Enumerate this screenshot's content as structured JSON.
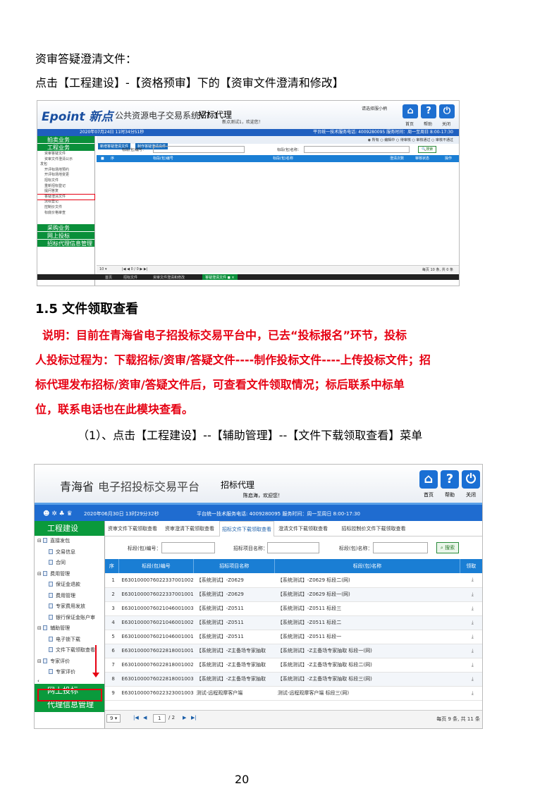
{
  "doc": {
    "p1": "资审答疑澄清文件：",
    "p2": "点击【工程建设】-【资格预审】下的【资审文件澄清和修改】",
    "h15": "1.5 文件领取查看",
    "note": [
      "说明：目前在青海省电子招投标交易平台中，已去“投标报名”环节，投标",
      "人投标过程为：下载招标/资审/答疑文件----制作投标文件----上传投标文件；招",
      "标代理发布招标/资审/答疑文件后，可查看文件领取情况；标后联系中标单",
      "位，联系电话也在此模块查看。"
    ],
    "p3": "（1）、点击【工程建设】--【辅助管理】--【文件下载领取查看】菜单",
    "page": "20"
  },
  "shot1": {
    "logo": "Epoint 新点",
    "system": "公共资源电子交易系统V7.1",
    "role": "招标代理",
    "user": "新点测试1，欢迎您！",
    "select_hint": "请选择服小柄",
    "icons": [
      {
        "name": "home-icon",
        "glyph": "⌂",
        "label": "首页"
      },
      {
        "name": "help-icon",
        "glyph": "?",
        "label": "帮助"
      },
      {
        "name": "power-icon",
        "glyph": "⏻",
        "label": "关闭"
      }
    ],
    "date": "2020年07月24日 11时34分51秒",
    "hotline": "平台统一技术服务电话: 4009280095 服务时间：周一至周日 8:00-17:30",
    "side_groups_top": [
      "拍卖业务",
      "工程业务"
    ],
    "tree": [
      "资审答疑文件",
      "资审文件澄清公示",
      "发包",
      "开评标场地预约",
      "开评标场地变更",
      "招标文件",
      "重新招标登记",
      "提问答复",
      "答疑澄清文件",
      "流标登记",
      "控制价文件",
      "标底价格审查"
    ],
    "side_groups_bottom": [
      "采购业务",
      "网上投标",
      "招标代理信息管理"
    ],
    "btns": [
      "新增答疑澄清文件",
      "制作答疑澄清文件"
    ],
    "radios": [
      "所有",
      "编辑中",
      "待审核",
      "审核通过",
      "审核不通过"
    ],
    "filter": [
      "标段(包)编号：",
      "标段(包)名称："
    ],
    "search": "搜索",
    "cols": [
      "序",
      "标段(包)编号",
      "标段(包)名称",
      "澄清次数",
      "审核状态",
      "操作"
    ],
    "pager": "每页 10 条, 共 0 条",
    "pager_size": "10",
    "pager_page": "0",
    "pager_total": "/ 0",
    "bottom_tabs": [
      "首页",
      "招标文件",
      "资审文件澄清和修改",
      "答疑澄清文件"
    ]
  },
  "shot2": {
    "province": "青海省",
    "platform": "电子招投标交易平台",
    "role": "招标代理",
    "user": "陈启海，欢迎您！",
    "icons": [
      {
        "name": "home-icon",
        "glyph": "⌂",
        "label": "首页"
      },
      {
        "name": "help-icon",
        "glyph": "?",
        "label": "帮助"
      },
      {
        "name": "power-icon",
        "glyph": "⏻",
        "label": "关闭"
      }
    ],
    "date": "2020年06月30日 13时29分32秒",
    "hotline": "平台统一技术服务电话: 4009280095 服务时间：周一至周日 8:00-17:30",
    "side_title": "工程建设",
    "tree": [
      {
        "t": "直接发包",
        "lvl": 0
      },
      {
        "t": "交易信息",
        "lvl": 1
      },
      {
        "t": "合同",
        "lvl": 1
      },
      {
        "t": "费用管理",
        "lvl": 0
      },
      {
        "t": "保证金退款",
        "lvl": 1
      },
      {
        "t": "费用管理",
        "lvl": 1
      },
      {
        "t": "专家费用发放",
        "lvl": 1
      },
      {
        "t": "银行保证金账户审",
        "lvl": 1
      },
      {
        "t": "辅助管理",
        "lvl": 0
      },
      {
        "t": "电子锁下载",
        "lvl": 1
      },
      {
        "t": "文件下载领取查看",
        "lvl": 1
      },
      {
        "t": "专家评价",
        "lvl": 0
      },
      {
        "t": "专家评价",
        "lvl": 1
      }
    ],
    "side_bottom": [
      "网上投标",
      "代理信息管理"
    ],
    "tabs": [
      "资审文件下载领取查看",
      "资审澄清下载领取查看",
      "招标文件下载领取查看",
      "澄清文件下载领取查看",
      "招标控制价文件下载领取查看"
    ],
    "filter": [
      "标段(包)编号：",
      "招标项目名称：",
      "标段(包)名称："
    ],
    "search": "搜索",
    "cols": [
      "序",
      "标段(包)编号",
      "招标项目名称",
      "标段(包)名称",
      "领取"
    ],
    "rows": [
      [
        "1",
        "E6301000076022337001002",
        "【系统测试】-Z0629",
        "【系统测试】-Z0629 标段二(网)"
      ],
      [
        "2",
        "E6301000076022337001001",
        "【系统测试】-Z0629",
        "【系统测试】-Z0629 标段一(网)"
      ],
      [
        "3",
        "E6301000076021046001003",
        "【系统测试】-Z0511",
        "【系统测试】-Z0511 标段三"
      ],
      [
        "4",
        "E6301000076021046001002",
        "【系统测试】-Z0511",
        "【系统测试】-Z0511 标段二"
      ],
      [
        "5",
        "E6301000076021046001001",
        "【系统测试】-Z0511",
        "【系统测试】-Z0511 标段一"
      ],
      [
        "6",
        "E6301000076022818001001",
        "【系统测试】-Z主备场专家抽取",
        "【系统测试】-Z主备场专家抽取 标段一(网)"
      ],
      [
        "7",
        "E6301000076022818001002",
        "【系统测试】-Z主备场专家抽取",
        "【系统测试】-Z主备场专家抽取 标段二(网)"
      ],
      [
        "8",
        "E6301000076022818001003",
        "【系统测试】-Z主备场专家抽取",
        "【系统测试】-Z主备场专家抽取 标段三(网)"
      ],
      [
        "9",
        "E6301000076022323001003",
        "测试-远程观摩客户端",
        "测试-远程观摩客户端 标段三(网)"
      ]
    ],
    "pager_size": "9",
    "pager_page": "1",
    "pager_total": "/ 2",
    "pager": "每页 9 条, 共 11 条"
  }
}
